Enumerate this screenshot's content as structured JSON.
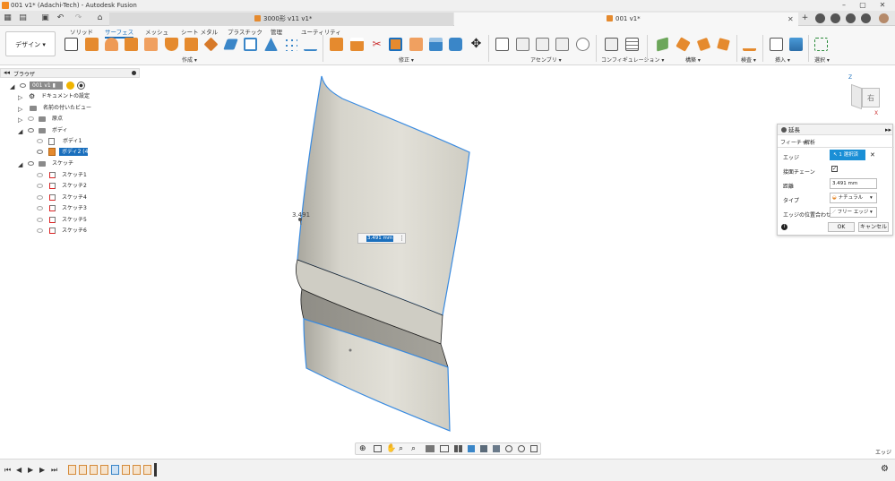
{
  "window": {
    "title": "001 v1* (Adachi-Tech) - Autodesk Fusion"
  },
  "tabs": [
    {
      "label": "3000形 v11 v1*"
    },
    {
      "label": "001 v1*"
    }
  ],
  "ribbon": {
    "workspace": "デザイン",
    "tabs": [
      "ソリッド",
      "サーフェス",
      "メッシュ",
      "シート メタル",
      "プラスチック",
      "管理",
      "ユーティリティ"
    ],
    "active_tab": "サーフェス",
    "groups": [
      "作成",
      "修正",
      "アセンブリ",
      "コンフィギュレーション",
      "構築",
      "検査",
      "挿入",
      "選択"
    ]
  },
  "browser": {
    "title": "ブラウザ",
    "root": "001 v1",
    "items": [
      {
        "label": "ドキュメントの設定"
      },
      {
        "label": "名前の付いたビュー"
      },
      {
        "label": "原点"
      },
      {
        "label": "ボディ"
      },
      {
        "label": "ボディ1"
      },
      {
        "label": "ボディ2 (4)"
      },
      {
        "label": "スケッチ"
      },
      {
        "label": "スケッチ1"
      },
      {
        "label": "スケッチ2"
      },
      {
        "label": "スケッチ4"
      },
      {
        "label": "スケッチ3"
      },
      {
        "label": "スケッチ5"
      },
      {
        "label": "スケッチ6"
      }
    ]
  },
  "viewport": {
    "dimension_label": "3.491",
    "input_value": "3.491 mm",
    "viewcube_face": "右",
    "status_text": "エッジ"
  },
  "panel": {
    "title": "延長",
    "tabs": [
      "フィーチャ",
      "解析"
    ],
    "rows": [
      {
        "label": "エッジ",
        "value": "1 選択済"
      },
      {
        "label": "接面チェーン",
        "value": ""
      },
      {
        "label": "距離",
        "value": "3.491 mm"
      },
      {
        "label": "タイプ",
        "value": "ナチュラル"
      },
      {
        "label": "エッジの位置合わせ",
        "value": "フリー エッジ"
      }
    ],
    "ok": "OK",
    "cancel": "キャンセル"
  },
  "colors": {
    "accent": "#1a6fbd",
    "surface_edge": "#3a8be0",
    "orange": "#e58a2e"
  }
}
